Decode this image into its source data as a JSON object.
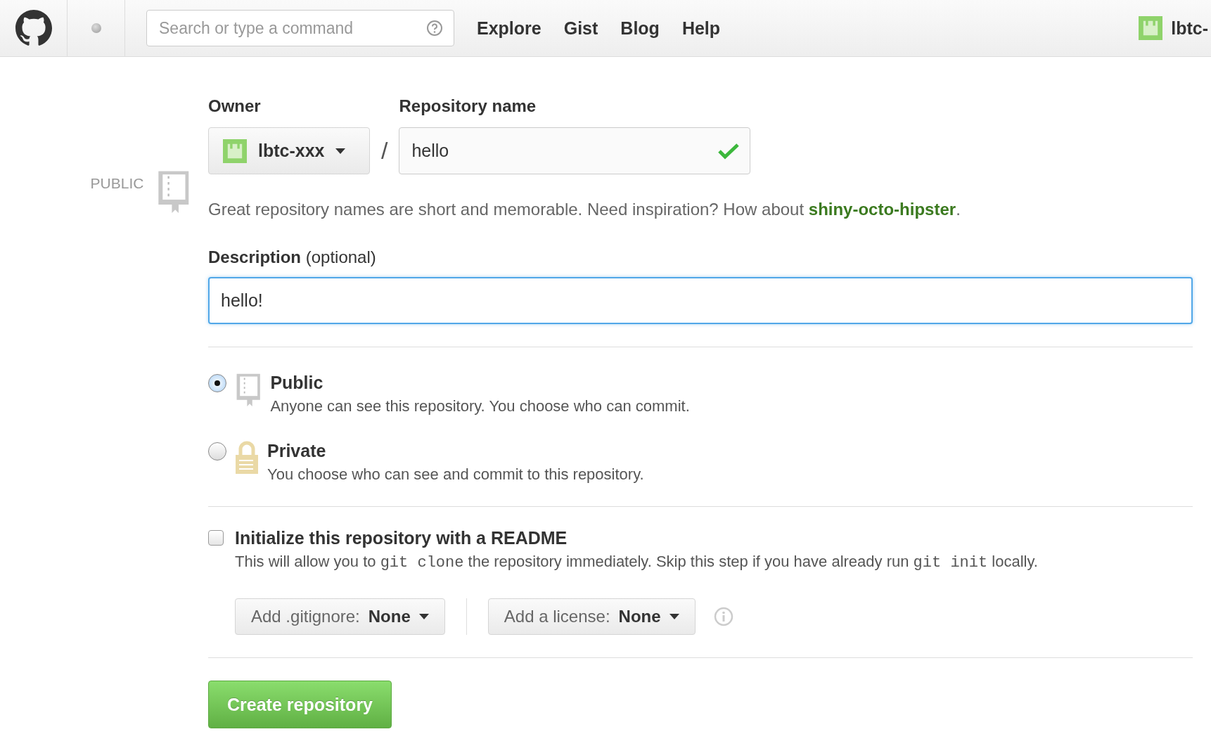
{
  "header": {
    "search": {
      "placeholder": "Search or type a command"
    },
    "nav": [
      "Explore",
      "Gist",
      "Blog",
      "Help"
    ],
    "user": "lbtc-"
  },
  "form": {
    "visibility_badge": "PUBLIC",
    "owner_label": "Owner",
    "owner": "lbtc-xxx",
    "separator": "/",
    "name_label": "Repository name",
    "name": "hello",
    "name_valid": true,
    "hint": {
      "text": "Great repository names are short and memorable. Need inspiration? How about ",
      "suggestion": "shiny-octo-hipster",
      "end": "."
    },
    "description_label": "**Description** (optional)",
    "description": "hello!",
    "visibility": [
      {
        "kind": "public",
        "title": "Public",
        "text": "Anyone can see this repository. You choose who can commit.",
        "selected": true
      },
      {
        "kind": "private",
        "title": "Private",
        "text": "You choose who can see and commit to this repository.",
        "selected": false
      }
    ],
    "readme": {
      "label": "Initialize this repository with a README",
      "checked": false,
      "text": [
        {
          "kind": "text",
          "s": "This will allow you to "
        },
        {
          "kind": "code",
          "s": "git clone"
        },
        {
          "kind": "text",
          "s": " the repository immediately. Skip this step if you have already run "
        },
        {
          "kind": "code",
          "s": "git init"
        },
        {
          "kind": "text",
          "s": " locally."
        }
      ]
    },
    "gitignore": {
      "label": "Add .gitignore:",
      "value": "None"
    },
    "license": {
      "label": "Add a license:",
      "value": "None"
    },
    "submit": "Create repository"
  }
}
